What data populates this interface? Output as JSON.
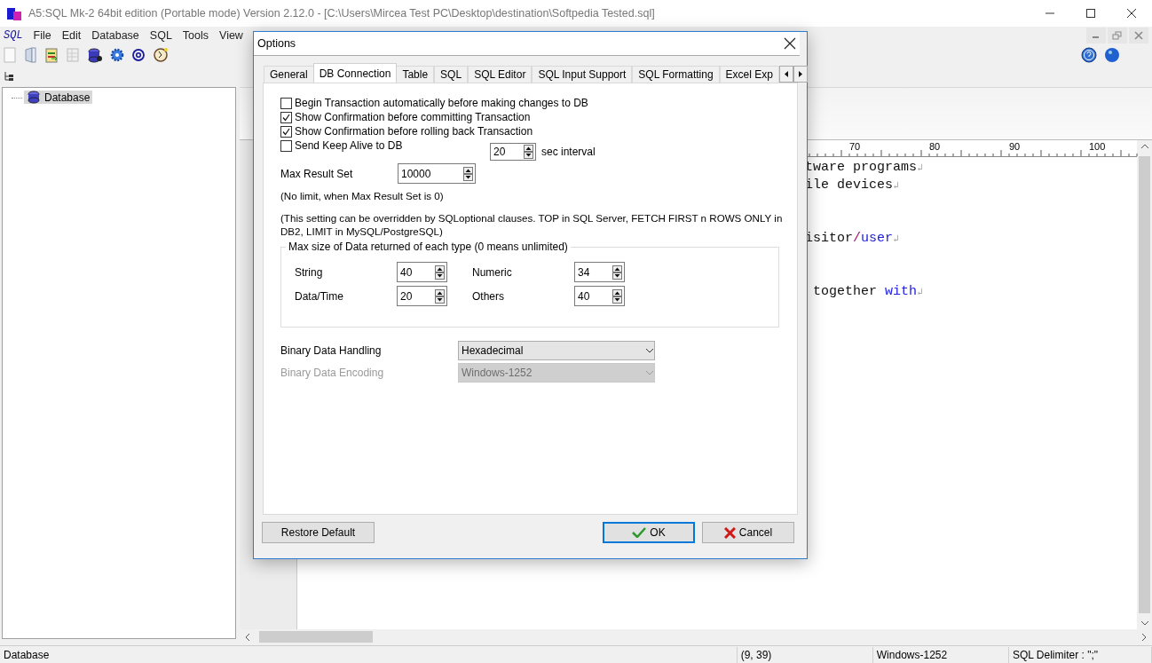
{
  "window": {
    "title": "A5:SQL Mk-2 64bit edition (Portable mode) Version 2.12.0 - [C:\\Users\\Mircea Test PC\\Desktop\\destination\\Softpedia Tested.sql]"
  },
  "menu": {
    "logo": "SQL",
    "items": [
      "File",
      "Edit",
      "Database",
      "SQL",
      "Tools",
      "View"
    ]
  },
  "tree": {
    "items": [
      {
        "label": "Database",
        "selected": true
      }
    ]
  },
  "editor": {
    "ruler": [
      "70",
      "80",
      "90",
      "100"
    ],
    "lines": [
      {
        "kind": "text",
        "segments": [
          {
            "text": "tware programs",
            "kind": "plain"
          }
        ],
        "eol": "↲"
      },
      {
        "kind": "text",
        "segments": [
          {
            "text": "ile devices",
            "kind": "plain"
          }
        ],
        "eol": "↲"
      },
      {
        "kind": "blank"
      },
      {
        "kind": "blank"
      },
      {
        "kind": "text",
        "segments": [
          {
            "text": "isitor",
            "kind": "plain"
          },
          {
            "text": "/",
            "kind": "operator"
          },
          {
            "text": "user",
            "kind": "keyword"
          }
        ],
        "eol": "↲"
      },
      {
        "kind": "blank"
      },
      {
        "kind": "blank"
      },
      {
        "kind": "text",
        "segments": [
          {
            "text": "together",
            "kind": "plain"
          },
          {
            "text": "with",
            "kind": "keyword"
          }
        ],
        "eol": "↲"
      }
    ]
  },
  "status_bar": {
    "fields": [
      "Database",
      "(9, 39)",
      "Windows-1252",
      "SQL Delimiter : \";\""
    ]
  },
  "dialog": {
    "title": "Options",
    "tabs": [
      {
        "label": "General",
        "selected": false
      },
      {
        "label": "DB Connection",
        "selected": true
      },
      {
        "label": "Table",
        "selected": false
      },
      {
        "label": "SQL",
        "selected": false
      },
      {
        "label": "SQL Editor",
        "selected": false
      },
      {
        "label": "SQL Input Support",
        "selected": false
      },
      {
        "label": "SQL Formatting",
        "selected": false
      },
      {
        "label": "Excel Exp",
        "selected": false
      }
    ],
    "checkboxes": [
      {
        "label": "Begin Transaction automatically before making changes to DB",
        "checked": false
      },
      {
        "label": "Show Confirmation before committing Transaction",
        "checked": true
      },
      {
        "label": "Show Confirmation before rolling back Transaction",
        "checked": true
      },
      {
        "label": "Send Keep Alive to DB",
        "checked": false
      }
    ],
    "keep_alive": {
      "value": "20",
      "unit": "sec interval"
    },
    "max_result_set": {
      "label": "Max Result Set",
      "value": "10000"
    },
    "notes": [
      "(No limit, when Max Result Set is 0)",
      "(This setting can be overridden by SQLoptional clauses. TOP in SQL Server, FETCH FIRST n ROWS ONLY in DB2,  LIMIT in MySQL/PostgreSQL)"
    ],
    "group": {
      "title": "Max size of Data returned of each type (0 means unlimited)",
      "fields": [
        {
          "label": "String",
          "value": "40"
        },
        {
          "label": "Numeric",
          "value": "34"
        },
        {
          "label": "Data/Time",
          "value": "20"
        },
        {
          "label": "Others",
          "value": "40"
        }
      ]
    },
    "selects": [
      {
        "label": "Binary Data Handling",
        "value": "Hexadecimal",
        "disabled": false
      },
      {
        "label": "Binary Data Encoding",
        "value": "Windows-1252",
        "disabled": true
      }
    ],
    "buttons": [
      {
        "label": "Restore Default",
        "kind": "plain"
      },
      {
        "label": "OK",
        "kind": "ok"
      },
      {
        "label": "Cancel",
        "kind": "cancel"
      }
    ]
  }
}
